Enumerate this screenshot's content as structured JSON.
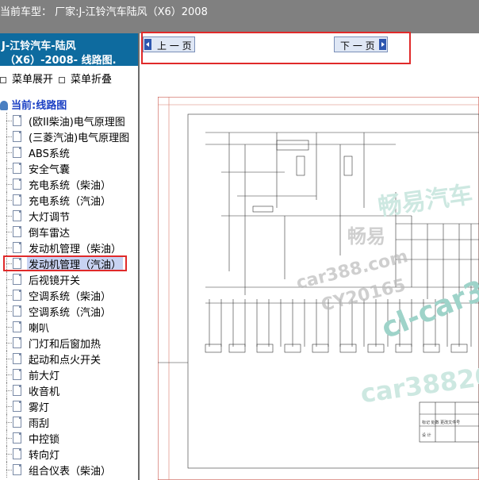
{
  "topbar": {
    "title": "当前车型：  厂家:J-江铃汽车陆风（X6）2008"
  },
  "sidebar": {
    "header_line1": "J-江铃汽车-陆风",
    "header_line2": "（X6）-2008- 线路图.",
    "expand_label": "菜单展开",
    "collapse_label": "菜单折叠",
    "current_label": "当前:线路图",
    "items": [
      {
        "label": "(欧II柴油)电气原理图"
      },
      {
        "label": "(三菱汽油)电气原理图"
      },
      {
        "label": "ABS系统"
      },
      {
        "label": "安全气囊"
      },
      {
        "label": "充电系统（柴油）"
      },
      {
        "label": "充电系统（汽油）"
      },
      {
        "label": "大灯调节"
      },
      {
        "label": "倒车雷达"
      },
      {
        "label": "发动机管理（柴油）"
      },
      {
        "label": "发动机管理（汽油）",
        "selected": true
      },
      {
        "label": "后视镜开关"
      },
      {
        "label": "空调系统（柴油）"
      },
      {
        "label": "空调系统（汽油）"
      },
      {
        "label": "喇叭"
      },
      {
        "label": "门灯和后窗加热"
      },
      {
        "label": "起动和点火开关"
      },
      {
        "label": "前大灯"
      },
      {
        "label": "收音机"
      },
      {
        "label": "雾灯"
      },
      {
        "label": "雨刮"
      },
      {
        "label": "中控锁"
      },
      {
        "label": "转向灯"
      },
      {
        "label": "组合仪表（柴油）"
      }
    ]
  },
  "nav": {
    "prev_label": "上 一 页",
    "next_label": "下 一 页"
  },
  "diagram": {
    "title_block_label": "标记 处数 更改文件号",
    "sub_label": "设 计"
  },
  "watermarks": {
    "w1": "畅易汽车",
    "w2": "畅易",
    "w3": "car388.com",
    "w4": "CY20165",
    "w5": "cl-car3",
    "w6": "car38820"
  },
  "colors": {
    "topbar_bg": "#808080",
    "sidebar_header_bg": "#0e6b9f",
    "highlight_red": "#e02a2a",
    "selected_bg": "#c8d3f2",
    "watermark_teal": "#9ed3c9"
  }
}
